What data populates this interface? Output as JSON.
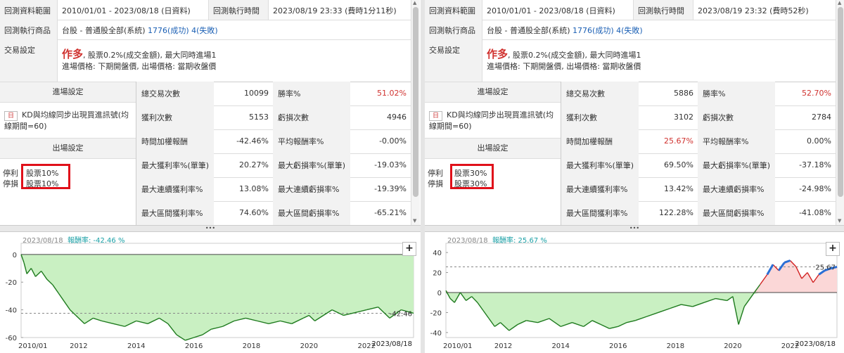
{
  "panels": [
    {
      "info": {
        "range_label": "回測資料範圍",
        "range_value": "2010/01/01 - 2023/08/18 (日資料)",
        "exec_time_label": "回測執行時間",
        "exec_time_value": "2023/08/19 23:33 (費時1分11秒)",
        "products_label": "回測執行商品",
        "products_prefix": "台股 - 普通股全部(系統) ",
        "products_counts": "1776(成功) 4(失敗)",
        "trade_label": "交易設定",
        "trade_direction": "作多",
        "trade_desc": ", 股票0.2%(成交金額), 最大同時進場1",
        "trade_desc2": "進場價格: 下期開盤價, 出場價格: 當期收盤價"
      },
      "settings": {
        "entry_header": "進場設定",
        "entry_tag": "日",
        "entry_text": "KD與均線同步出現買進訊號(均線期間=60)",
        "exit_header": "出場設定",
        "stop_profit_label": "停利",
        "stop_profit_value": "股票10%",
        "stop_loss_label": "停損",
        "stop_loss_value": "股票10%"
      },
      "stats": [
        [
          "總交易次數",
          "10099",
          "勝率%",
          "51.02%"
        ],
        [
          "獲利次數",
          "5153",
          "虧損次數",
          "4946"
        ],
        [
          "時間加權報酬",
          "-42.46%",
          "平均報酬率%",
          "-0.00%"
        ],
        [
          "最大獲利率%(單筆)",
          "20.27%",
          "最大虧損率%(單筆)",
          "-19.03%"
        ],
        [
          "最大連續獲利率%",
          "13.08%",
          "最大連續虧損率%",
          "-19.39%"
        ],
        [
          "最大區間獲利率%",
          "74.60%",
          "最大區間虧損率%",
          "-65.21%"
        ]
      ],
      "stats_red_values": [
        "51.02%"
      ],
      "chart": {
        "date": "2023/08/18",
        "return_label": "報酬率: -42.46 %",
        "end_value_label": "-42.46",
        "end_date_label": "2023/08/18",
        "plus": "+",
        "handle": "•••"
      }
    },
    {
      "info": {
        "range_label": "回測資料範圍",
        "range_value": "2010/01/01 - 2023/08/18 (日資料)",
        "exec_time_label": "回測執行時間",
        "exec_time_value": "2023/08/19 23:32 (費時52秒)",
        "products_label": "回測執行商品",
        "products_prefix": "台股 - 普通股全部(系統) ",
        "products_counts": "1776(成功) 4(失敗)",
        "trade_label": "交易設定",
        "trade_direction": "作多",
        "trade_desc": ", 股票0.2%(成交金額), 最大同時進場1",
        "trade_desc2": "進場價格: 下期開盤價, 出場價格: 當期收盤價"
      },
      "settings": {
        "entry_header": "進場設定",
        "entry_tag": "日",
        "entry_text": "KD與均線同步出現買進訊號(均線期間=60)",
        "exit_header": "出場設定",
        "stop_profit_label": "停利",
        "stop_profit_value": "股票30%",
        "stop_loss_label": "停損",
        "stop_loss_value": "股票30%"
      },
      "stats": [
        [
          "總交易次數",
          "5886",
          "勝率%",
          "52.70%"
        ],
        [
          "獲利次數",
          "3102",
          "虧損次數",
          "2784"
        ],
        [
          "時間加權報酬",
          "25.67%",
          "平均報酬率%",
          "0.00%"
        ],
        [
          "最大獲利率%(單筆)",
          "69.50%",
          "最大虧損率%(單筆)",
          "-37.18%"
        ],
        [
          "最大連續獲利率%",
          "13.42%",
          "最大連續虧損率%",
          "-24.98%"
        ],
        [
          "最大區間獲利率%",
          "122.28%",
          "最大區間虧損率%",
          "-41.08%"
        ]
      ],
      "stats_red_values": [
        "52.70%",
        "25.67%"
      ],
      "chart": {
        "date": "2023/08/18",
        "return_label": "報酬率: 25.67 %",
        "end_value_label": "25.67",
        "end_date_label": "2023/08/18",
        "plus": "+",
        "handle": "•••"
      }
    }
  ],
  "chart_data": [
    {
      "type": "area",
      "ylim": [
        -60,
        5
      ],
      "yticks": [
        0,
        -20,
        -40,
        -60
      ],
      "xticks": [
        "2010/01",
        "2012",
        "2014",
        "2016",
        "2018",
        "2020",
        "2022"
      ],
      "x_range": [
        2010.0,
        2023.63
      ],
      "colors": {
        "fill": "#c9f0c2",
        "line": "#1e7a1e",
        "dashed": "#888888"
      },
      "series": [
        {
          "x": [
            2010.0,
            2010.1,
            2010.2,
            2010.35,
            2010.5,
            2010.7,
            2010.9,
            2011.1,
            2011.3,
            2011.5,
            2011.7,
            2011.9,
            2012.2,
            2012.5,
            2012.8,
            2013.2,
            2013.6,
            2014.0,
            2014.4,
            2014.8,
            2015.1,
            2015.4,
            2015.7,
            2016.0,
            2016.3,
            2016.6,
            2017.0,
            2017.4,
            2017.8,
            2018.2,
            2018.6,
            2019.0,
            2019.4,
            2019.8,
            2020.0,
            2020.2,
            2020.5,
            2020.8,
            2021.2,
            2021.6,
            2022.0,
            2022.4,
            2022.8,
            2023.2,
            2023.63
          ],
          "y": [
            0,
            -6,
            -14,
            -10,
            -16,
            -12,
            -18,
            -22,
            -28,
            -34,
            -40,
            -44,
            -50,
            -46,
            -48,
            -50,
            -52,
            -48,
            -50,
            -46,
            -50,
            -58,
            -62,
            -60,
            -58,
            -54,
            -52,
            -48,
            -46,
            -48,
            -50,
            -48,
            -50,
            -46,
            -44,
            -48,
            -44,
            -40,
            -44,
            -42,
            -40,
            -38,
            -46,
            -40,
            -42.46
          ]
        }
      ]
    },
    {
      "type": "area",
      "ylim": [
        -45,
        45
      ],
      "yticks": [
        40,
        20,
        0,
        -20,
        -40
      ],
      "xticks": [
        "2010/01",
        "2012",
        "2014",
        "2016",
        "2018",
        "2020",
        "2022"
      ],
      "x_range": [
        2010.0,
        2023.63
      ],
      "colors": {
        "fill": "#c9f0c2",
        "fill_positive": "#fbd7d7",
        "line": "#1e7a1e",
        "line_positive": "#d22020",
        "highlight": "#2a6fd6",
        "dashed": "#888888"
      },
      "series": [
        {
          "x": [
            2010.0,
            2010.15,
            2010.3,
            2010.5,
            2010.7,
            2010.9,
            2011.1,
            2011.3,
            2011.5,
            2011.7,
            2011.9,
            2012.2,
            2012.5,
            2012.8,
            2013.2,
            2013.6,
            2014.0,
            2014.4,
            2014.8,
            2015.1,
            2015.4,
            2015.7,
            2016.0,
            2016.3,
            2016.6,
            2017.0,
            2017.4,
            2017.8,
            2018.2,
            2018.6,
            2019.0,
            2019.4,
            2019.8,
            2020.0,
            2020.2,
            2020.4,
            2020.7,
            2020.95,
            2021.2,
            2021.4,
            2021.6,
            2021.8,
            2022.0,
            2022.2,
            2022.4,
            2022.6,
            2022.8,
            2023.0,
            2023.2,
            2023.4,
            2023.63
          ],
          "y": [
            2,
            -6,
            -10,
            0,
            -8,
            -4,
            -10,
            -18,
            -26,
            -34,
            -30,
            -38,
            -32,
            -28,
            -30,
            -26,
            -34,
            -30,
            -34,
            -28,
            -32,
            -36,
            -34,
            -30,
            -28,
            -24,
            -20,
            -16,
            -12,
            -14,
            -10,
            -6,
            -8,
            -4,
            -32,
            -14,
            -2,
            8,
            18,
            28,
            22,
            30,
            32,
            26,
            14,
            20,
            10,
            18,
            22,
            24,
            25.67
          ]
        }
      ]
    }
  ]
}
